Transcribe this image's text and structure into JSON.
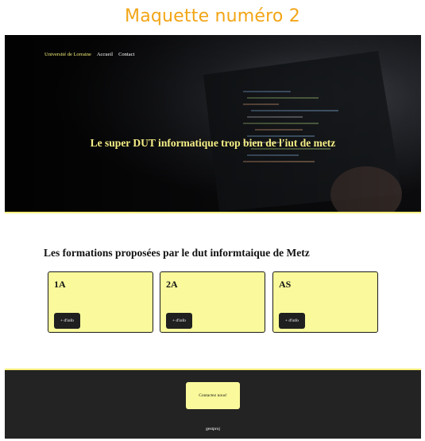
{
  "mockup": {
    "title": "Maquette numéro 2"
  },
  "nav": {
    "brand": "Université de Lorraine",
    "links": [
      "Accueil",
      "Contact"
    ]
  },
  "hero": {
    "title": "Le super DUT informatique trop bien de l'iut de metz"
  },
  "formations": {
    "title": "Les formations proposées par le dut informtaique de Metz",
    "cards": [
      {
        "title": "1A",
        "button": "+ d'info"
      },
      {
        "title": "2A",
        "button": "+ d'info"
      },
      {
        "title": "AS",
        "button": "+ d'info"
      }
    ]
  },
  "footer": {
    "contact_button": "Contactez nous!",
    "text": "gestproj"
  },
  "colors": {
    "accent_yellow": "#fafa9c",
    "hero_text": "#f6ef86",
    "mockup_title": "#f2a516",
    "dark": "#232323"
  }
}
